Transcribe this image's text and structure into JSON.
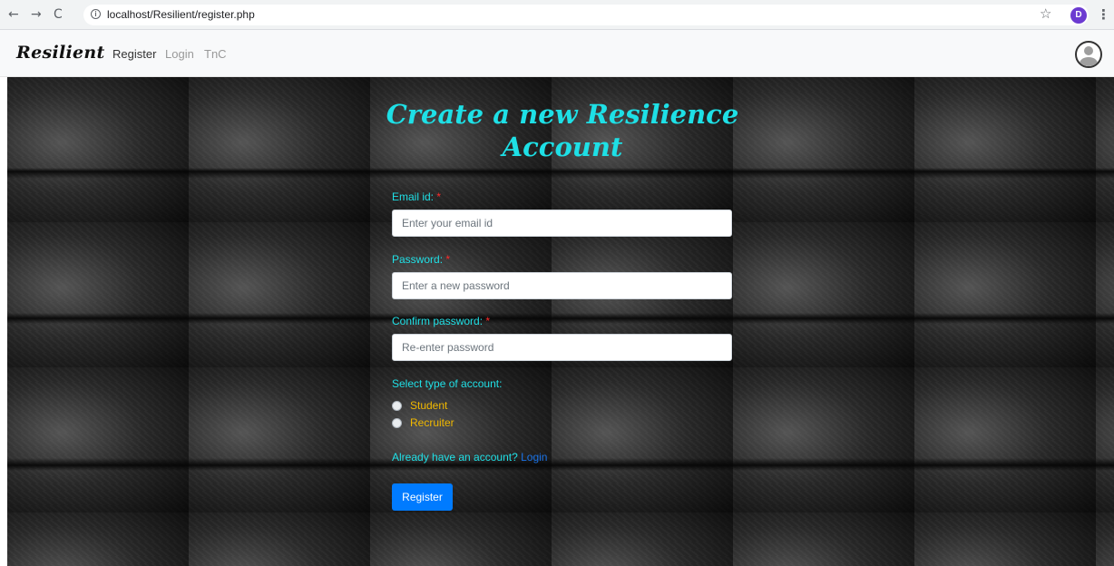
{
  "browser": {
    "back": "←",
    "forward": "→",
    "reload": "C",
    "url": "localhost/Resilient/register.php",
    "star": "☆",
    "profile_initial": "D",
    "menu": "⋮"
  },
  "navbar": {
    "brand": "Resilient",
    "links": [
      "Register",
      "Login",
      "TnC"
    ],
    "active_link": "Register"
  },
  "form": {
    "title": "Create a new Resilience Account",
    "email_label": "Email id:",
    "email_placeholder": "Enter your email id",
    "password_label": "Password:",
    "password_placeholder": "Enter a new password",
    "confirm_label": "Confirm password:",
    "confirm_placeholder": "Re-enter password",
    "required_mark": "*",
    "account_type_label": "Select type of account:",
    "account_types": [
      "Student",
      "Recruiter"
    ],
    "already_text": "Already have an account?",
    "login_link": "Login",
    "submit_label": "Register"
  },
  "colors": {
    "title": "#1ee0e6",
    "labels": "#20e0e6",
    "radio_labels": "#f0b800",
    "required": "#ff2b2b",
    "button": "#007bff"
  }
}
